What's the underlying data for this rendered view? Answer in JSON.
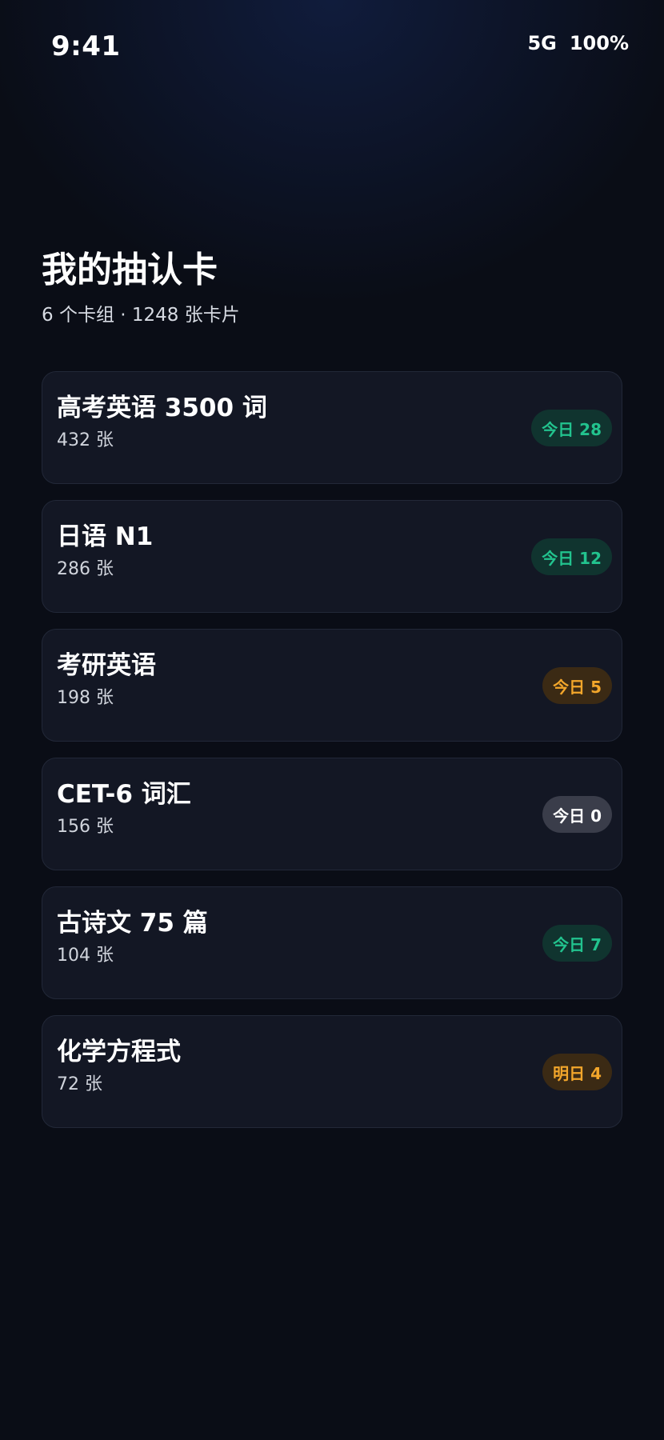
{
  "status_bar": {
    "time": "9:41",
    "network": "5G",
    "battery": "100%"
  },
  "header": {
    "title": "我的抽认卡",
    "subtitle": "6 个卡组 · 1248 张卡片"
  },
  "decks": [
    {
      "name": "高考英语 3500 词",
      "count": "432 张",
      "badge": "今日 28",
      "badge_status": "green"
    },
    {
      "name": "日语 N1",
      "count": "286 张",
      "badge": "今日 12",
      "badge_status": "green"
    },
    {
      "name": "考研英语",
      "count": "198 张",
      "badge": "今日 5",
      "badge_status": "orange"
    },
    {
      "name": "CET-6 词汇",
      "count": "156 张",
      "badge": "今日 0",
      "badge_status": "gray"
    },
    {
      "name": "古诗文 75 篇",
      "count": "104 张",
      "badge": "今日 7",
      "badge_status": "green"
    },
    {
      "name": "化学方程式",
      "count": "72 张",
      "badge": "明日 4",
      "badge_status": "orange"
    }
  ],
  "colors": {
    "background": "#0a0d16",
    "card": "#131724",
    "badge_green_text": "#22c38e",
    "badge_green_bg": "#10342f",
    "badge_orange_text": "#f2a62b",
    "badge_orange_bg": "#3b2a14",
    "badge_gray_bg": "#3a3d4a"
  }
}
